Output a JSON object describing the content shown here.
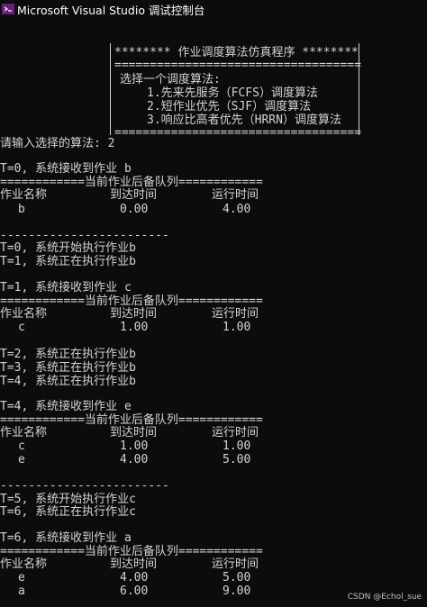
{
  "window": {
    "title": "Microsoft Visual Studio 调试控制台"
  },
  "menu": {
    "header": "******** 作业调度算法仿真程序 ********",
    "rule": "===================================",
    "prompt": "选择一个调度算法:",
    "options": [
      "1.先来先服务（FCFS）调度算法",
      "2.短作业优先（SJF）调度算法",
      "3.响应比高者优先（HRRN）调度算法"
    ]
  },
  "console": {
    "input_prompt": "请输入选择的算法: 2",
    "t0_receive": "T=0, 系统接收到作业 b",
    "queue_header": "============当前作业后备队列============",
    "col_name": "作业名称",
    "col_arrival": "到达时间",
    "col_runtime": "运行时间",
    "q1": [
      {
        "name": "b",
        "arrival": "0.00",
        "runtime": "4.00"
      }
    ],
    "separator": "------------------------",
    "t0_start": "T=0, 系统开始执行作业b",
    "t1_running": "T=1, 系统正在执行作业b",
    "t1_receive": "T=1, 系统接收到作业 c",
    "q2": [
      {
        "name": "c",
        "arrival": "1.00",
        "runtime": "1.00"
      }
    ],
    "t2_running": "T=2, 系统正在执行作业b",
    "t3_running": "T=3, 系统正在执行作业b",
    "t4_running": "T=4, 系统正在执行作业b",
    "t4_receive": "T=4, 系统接收到作业 e",
    "q3": [
      {
        "name": "c",
        "arrival": "1.00",
        "runtime": "1.00"
      },
      {
        "name": "e",
        "arrival": "4.00",
        "runtime": "5.00"
      }
    ],
    "t5_start": "T=5, 系统开始执行作业c",
    "t6_running": "T=6, 系统正在执行作业c",
    "t6_receive": "T=6, 系统接收到作业 a",
    "q4": [
      {
        "name": "e",
        "arrival": "4.00",
        "runtime": "5.00"
      },
      {
        "name": "a",
        "arrival": "6.00",
        "runtime": "9.00"
      }
    ]
  },
  "watermark": "CSDN @Echol_sue"
}
